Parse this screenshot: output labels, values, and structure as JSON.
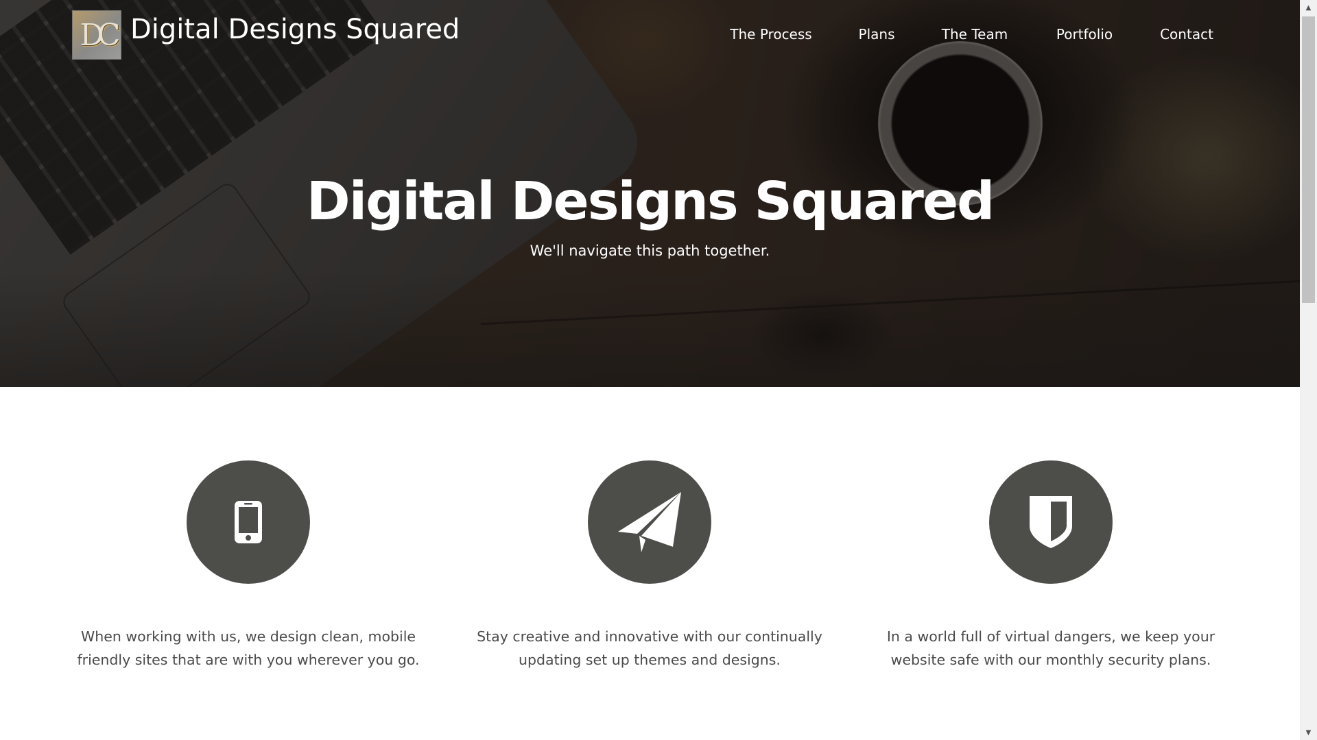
{
  "header": {
    "logo_text": "DC",
    "brand": "Digital Designs Squared",
    "nav": [
      {
        "label": "The Process"
      },
      {
        "label": "Plans"
      },
      {
        "label": "The Team"
      },
      {
        "label": "Portfolio"
      },
      {
        "label": "Contact"
      }
    ]
  },
  "hero": {
    "title": "Digital Designs Squared",
    "subtitle": "We'll navigate this path together."
  },
  "features": [
    {
      "icon": "mobile-phone-icon",
      "text": "When working with us, we design clean, mobile friendly sites that are with you wherever you go."
    },
    {
      "icon": "paper-plane-icon",
      "text": "Stay creative and innovative with our continually updating set up themes and designs."
    },
    {
      "icon": "shield-icon",
      "text": "In a world full of virtual dangers, we keep your website safe with our monthly security plans."
    }
  ],
  "colors": {
    "icon_circle": "#4d4d49",
    "body_text": "#4a4a4a",
    "hero_text": "#ffffff"
  }
}
